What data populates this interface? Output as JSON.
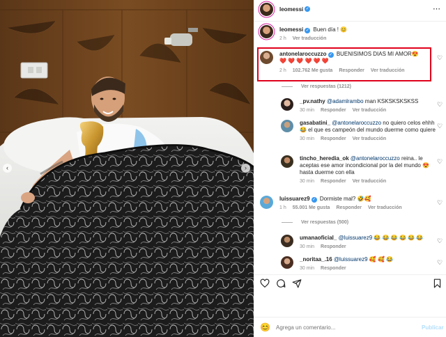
{
  "header": {
    "username": "leomessi",
    "more": "⋯"
  },
  "post": {
    "username": "leomessi",
    "caption": "Buen día ! 😊",
    "time": "2 h",
    "translate": "Ver traducción"
  },
  "comments": [
    {
      "username": "antonelaroccuzzo",
      "text": "BUENISIMOS DIAS MI AMOR😍 ❤️ ❤️ ❤️ ❤️ ❤️ ❤️",
      "time": "2 h",
      "likes": "102.762 Me gusta",
      "reply": "Responder",
      "translate": "Ver traducción",
      "view_replies": "Ver respuestas (1212)",
      "replies": [
        {
          "username": "_pv.nathy",
          "mention": "@adamlrambo",
          "text": " man KSKSKSKSKSS",
          "time": "30 min",
          "reply": "Responder",
          "translate": "Ver traducción"
        },
        {
          "username": "gasabatini_",
          "mention": "@antonelaroccuzzo",
          "text": " no quiero celos ehhh 😂 el que es campeón del mundo duerme como quiere",
          "time": "30 min",
          "reply": "Responder",
          "translate": "Ver traducción"
        },
        {
          "username": "tincho_heredia_ok",
          "mention": "@antonelaroccuzzo",
          "text": " reina.. le aceptas ese amor incondicional por la del mundo 😍 hasta duerme con ella",
          "time": "30 min",
          "reply": "Responder",
          "translate": "Ver traducción"
        }
      ]
    },
    {
      "username": "luissuarez9",
      "text": "Dormiste mal? 🤣🥰",
      "time": "1 h",
      "likes": "55.001 Me gusta",
      "reply": "Responder",
      "translate": "Ver traducción",
      "view_replies": "Ver respuestas (500)",
      "replies": [
        {
          "username": "umanaoficial_",
          "mention": "@luissuarez9",
          "text": " 😂 😂 😂 😂 😂 😂",
          "time": "30 min",
          "reply": "Responder",
          "translate": ""
        },
        {
          "username": "_noritaa_.16",
          "mention": "@luissuarez9",
          "text": " 🥰 🥰 😂",
          "time": "30 min",
          "reply": "Responder",
          "translate": ""
        }
      ]
    }
  ],
  "actions": {
    "like": "heart-outline-icon",
    "comment": "comment-bubble-icon",
    "share": "paper-plane-icon",
    "save": "bookmark-icon"
  },
  "composer": {
    "placeholder": "Agrega un comentario...",
    "submit": "Publicar",
    "emoji": "😊"
  },
  "colors": {
    "highlight_border": "#e0001b",
    "verified": "#3897f0",
    "link": "#00376b",
    "submit": "#b2dffc",
    "muted": "#8e8e8e"
  },
  "photo": {
    "prev_icon": "‹",
    "next_icon": "›"
  }
}
